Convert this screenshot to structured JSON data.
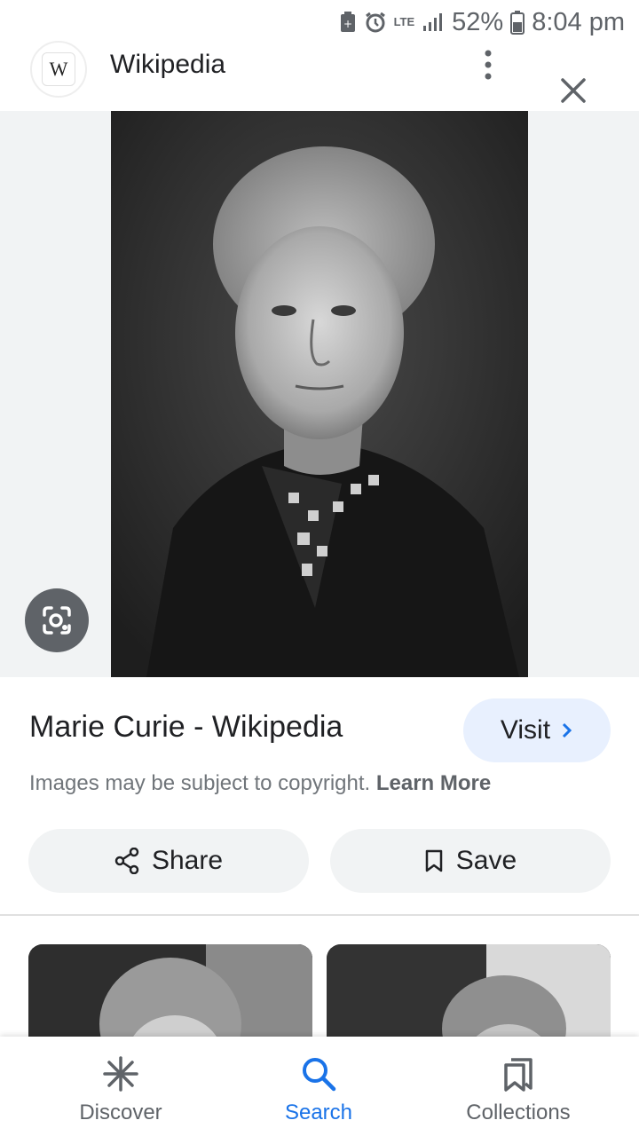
{
  "status_bar": {
    "network": "LTE",
    "battery": "52%",
    "time": "8:04 pm"
  },
  "header": {
    "favicon_letter": "W",
    "site_name": "Wikipedia"
  },
  "result": {
    "title": "Marie Curie - Wikipedia",
    "visit_label": "Visit",
    "copyright_text": "Images may be subject to copyright.",
    "learn_more": "Learn More",
    "share_label": "Share",
    "save_label": "Save"
  },
  "bottom_nav": {
    "items": [
      {
        "label": "Discover",
        "icon": "discover-icon"
      },
      {
        "label": "Search",
        "icon": "search-icon",
        "active": true
      },
      {
        "label": "Collections",
        "icon": "collections-icon"
      }
    ]
  },
  "colors": {
    "accent": "#1a73e8",
    "visit_bg": "#e8f0fe",
    "chip_bg": "#f1f3f4"
  }
}
